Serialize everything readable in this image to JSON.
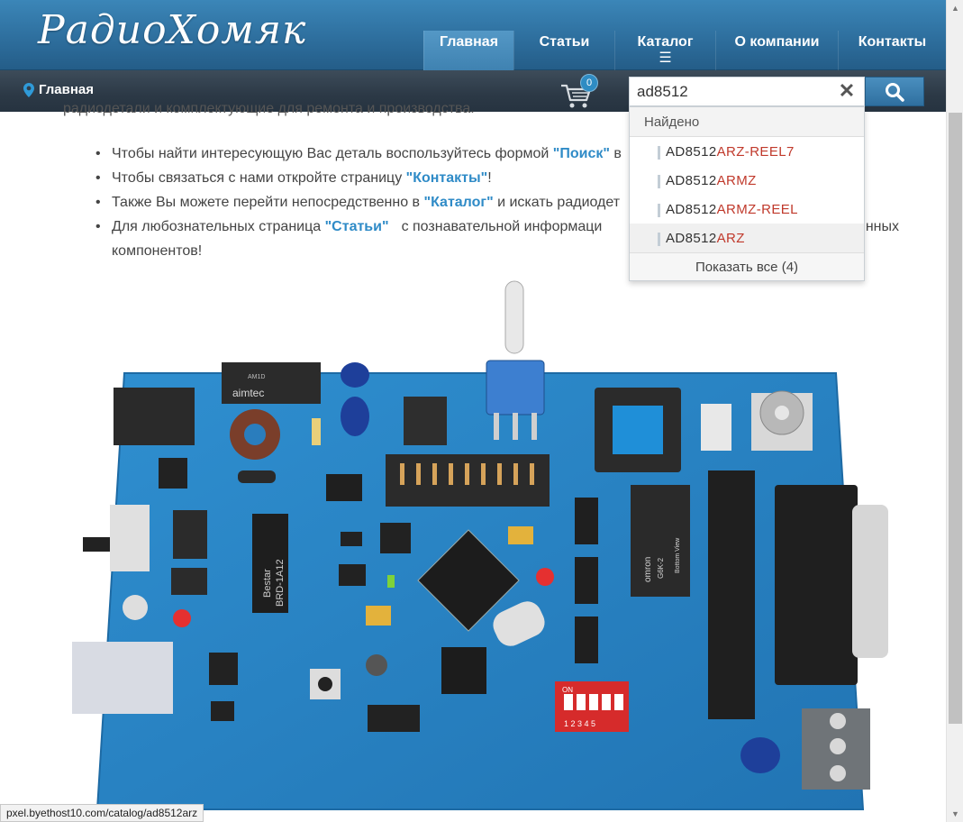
{
  "header": {
    "logo_text": "РадиоХомяк",
    "nav": [
      {
        "label": "Главная",
        "active": true
      },
      {
        "label": "Статьи",
        "active": false
      },
      {
        "label": "Каталог",
        "active": false,
        "menu_icon": "☰"
      },
      {
        "label": "О компании",
        "active": false
      },
      {
        "label": "Контакты",
        "active": false
      }
    ]
  },
  "subbar": {
    "breadcrumb": "Главная",
    "cart_count": "0",
    "search": {
      "value": "ad8512",
      "clear_icon": "✕",
      "button_icon": "search-icon"
    }
  },
  "dropdown": {
    "header": "Найдено",
    "items": [
      {
        "prefix": "AD8512",
        "rest": "ARZ-REEL7"
      },
      {
        "prefix": "AD8512",
        "rest": "ARMZ"
      },
      {
        "prefix": "AD8512",
        "rest": "ARMZ-REEL"
      },
      {
        "prefix": "AD8512",
        "rest": "ARZ"
      }
    ],
    "show_all": "Показать все (4)"
  },
  "content": {
    "top_line": "радиодетали и комплектующие для ремонта и производства.",
    "bullets": [
      {
        "before": "Чтобы найти интересующую Вас деталь воспользуйтесь формой ",
        "link": "\"Поиск\"",
        "after": " в"
      },
      {
        "before": "Чтобы связаться с нами откройте страницу ",
        "link": "\"Контакты\"",
        "after": "!"
      },
      {
        "before": "Также Вы можете перейти непосредственно в ",
        "link": "\"Каталог\"",
        "after": " и искать радиодет"
      },
      {
        "before": "Для любознательных страница ",
        "link": "\"Статьи\"",
        "after": " с познавательной информаци",
        "tail": "нных",
        "line2": "компонентов!"
      }
    ]
  },
  "status_url": "pxel.byethost10.com/catalog/ad8512arz",
  "colors": {
    "header_blue": "#2e6f9e",
    "link_blue": "#2f8bc7",
    "highlight_red": "#c0392b",
    "pcb_blue": "#2a86c6"
  },
  "board_labels": {
    "aimtec": "aimtec",
    "aimtec_sub": "AM1D",
    "bestar": "Bestar",
    "brd": "BRD-1A12",
    "omron": "omron",
    "g6k": "G6K-2",
    "bottom_view": "Bottom View",
    "dip_on": "ON",
    "dip_numbers": "1 2 3 4 5"
  }
}
